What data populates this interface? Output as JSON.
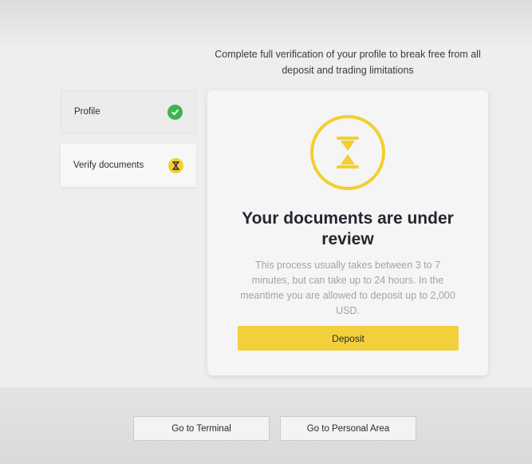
{
  "intro": {
    "line1": "Complete full verification of your profile to break free from all",
    "line2": "deposit and trading limitations"
  },
  "steps": [
    {
      "label": "Profile",
      "status": "completed",
      "icon": "check-icon",
      "color": "#3fb34f"
    },
    {
      "label": "Verify documents",
      "status": "pending",
      "icon": "hourglass-icon",
      "color": "#f2cf2e"
    }
  ],
  "review_card": {
    "icon": "hourglass-icon",
    "title_line1": "Your documents are under",
    "title_line2": "review",
    "desc_line1": "This process usually takes between 3 to 7",
    "desc_line2": "minutes, but can take up to 24 hours. In the",
    "desc_line3": "meantime you are allowed to deposit up to 2,000",
    "desc_line4": "USD.",
    "deposit_label": "Deposit"
  },
  "footer": {
    "terminal_label": "Go to Terminal",
    "personal_area_label": "Go to Personal Area"
  },
  "colors": {
    "accent": "#f2cf2e",
    "success": "#3fb34f",
    "background": "#eeeeee"
  }
}
